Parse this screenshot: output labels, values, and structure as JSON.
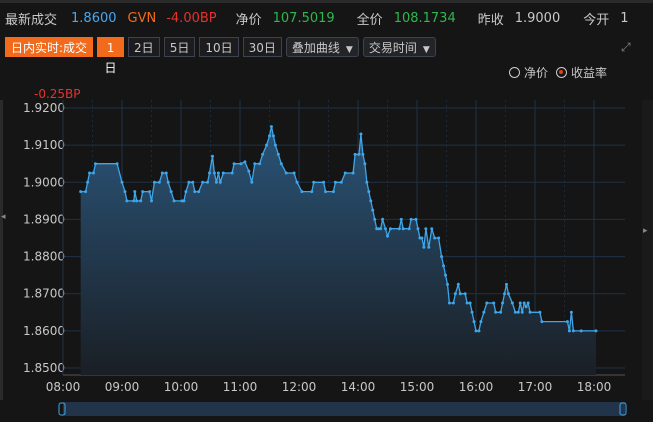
{
  "quote": {
    "latest_label": "最新成交",
    "latest": "1.8600",
    "gvn_label": "GVN",
    "gvn": "-4.00BP",
    "net_label": "净价",
    "net": "107.5019",
    "full_label": "全价",
    "full": "108.1734",
    "prev_label": "昨收",
    "prev": "1.9000",
    "open_label": "今开",
    "open": "1"
  },
  "toolbar": {
    "mode": "日内实时:成交",
    "ranges": [
      "1日",
      "2日",
      "5日",
      "10日",
      "30日"
    ],
    "active_range": "1日",
    "overlay": "叠加曲线",
    "hours": "交易时间"
  },
  "radio": {
    "net": "净价",
    "yield": "收益率",
    "selected": "yield"
  },
  "colors": {
    "accent": "#f26a1b",
    "line": "#3ea6ea",
    "up": "#2db84d",
    "down": "#e8312b",
    "blue": "#4aa8f0"
  },
  "chart_data": {
    "type": "area",
    "annotation": "-0.25BP",
    "ylim": [
      1.85,
      1.92
    ],
    "yticks": [
      "1.9200",
      "1.9100",
      "1.9000",
      "1.8900",
      "1.8800",
      "1.8700",
      "1.8600",
      "1.8500"
    ],
    "xticks": [
      "08:00",
      "09:00",
      "10:00",
      "11:00",
      "12:00",
      "14:00",
      "15:00",
      "16:00",
      "17:00",
      "18:00"
    ],
    "lunch_break": [
      "12:00",
      "13:00"
    ],
    "points": [
      [
        "08:18",
        1.8975
      ],
      [
        "08:23",
        1.8975
      ],
      [
        "08:25",
        1.9
      ],
      [
        "08:27",
        1.9025
      ],
      [
        "08:31",
        1.9025
      ],
      [
        "08:33",
        1.905
      ],
      [
        "08:55",
        1.905
      ],
      [
        "09:00",
        1.9
      ],
      [
        "09:03",
        1.8975
      ],
      [
        "09:05",
        1.895
      ],
      [
        "09:12",
        1.895
      ],
      [
        "09:13",
        1.8975
      ],
      [
        "09:15",
        1.895
      ],
      [
        "09:19",
        1.895
      ],
      [
        "09:21",
        1.8975
      ],
      [
        "09:28",
        1.8975
      ],
      [
        "09:30",
        1.895
      ],
      [
        "09:33",
        1.9
      ],
      [
        "09:38",
        1.9
      ],
      [
        "09:41",
        1.9025
      ],
      [
        "09:45",
        1.9025
      ],
      [
        "09:47",
        1.9
      ],
      [
        "09:50",
        1.8975
      ],
      [
        "09:53",
        1.895
      ],
      [
        "10:01",
        1.895
      ],
      [
        "10:03",
        1.895
      ],
      [
        "10:05",
        1.8975
      ],
      [
        "10:08",
        1.9
      ],
      [
        "10:12",
        1.9
      ],
      [
        "10:14",
        1.8975
      ],
      [
        "10:18",
        1.8975
      ],
      [
        "10:22",
        1.9
      ],
      [
        "10:27",
        1.9
      ],
      [
        "10:29",
        1.9025
      ],
      [
        "10:32",
        1.907
      ],
      [
        "10:34",
        1.9025
      ],
      [
        "10:36",
        1.9
      ],
      [
        "10:38",
        1.9025
      ],
      [
        "10:40",
        1.9
      ],
      [
        "10:43",
        1.9025
      ],
      [
        "10:52",
        1.9025
      ],
      [
        "10:54",
        1.905
      ],
      [
        "11:01",
        1.905
      ],
      [
        "11:05",
        1.9055
      ],
      [
        "11:09",
        1.903
      ],
      [
        "11:12",
        1.9
      ],
      [
        "11:15",
        1.905
      ],
      [
        "11:20",
        1.905
      ],
      [
        "11:23",
        1.9075
      ],
      [
        "11:27",
        1.91
      ],
      [
        "11:30",
        1.9125
      ],
      [
        "11:32",
        1.915
      ],
      [
        "11:34",
        1.9125
      ],
      [
        "11:36",
        1.91
      ],
      [
        "11:39",
        1.9075
      ],
      [
        "11:42",
        1.905
      ],
      [
        "11:47",
        1.9025
      ],
      [
        "11:55",
        1.9025
      ],
      [
        "11:58",
        1.9
      ],
      [
        "13:03",
        1.8975
      ],
      [
        "13:13",
        1.8975
      ],
      [
        "13:15",
        1.9
      ],
      [
        "13:25",
        1.9
      ],
      [
        "13:27",
        1.8975
      ],
      [
        "13:35",
        1.8975
      ],
      [
        "13:37",
        1.9
      ],
      [
        "13:43",
        1.9
      ],
      [
        "13:47",
        1.9025
      ],
      [
        "13:55",
        1.9025
      ],
      [
        "13:57",
        1.9075
      ],
      [
        "14:01",
        1.9075
      ],
      [
        "14:03",
        1.913
      ],
      [
        "14:05",
        1.9075
      ],
      [
        "14:07",
        1.905
      ],
      [
        "14:09",
        1.9
      ],
      [
        "14:11",
        1.8975
      ],
      [
        "14:13",
        1.895
      ],
      [
        "14:15",
        1.8925
      ],
      [
        "14:17",
        1.89
      ],
      [
        "14:19",
        1.8875
      ],
      [
        "14:21",
        1.8875
      ],
      [
        "14:23",
        1.8875
      ],
      [
        "14:25",
        1.89
      ],
      [
        "14:28",
        1.8875
      ],
      [
        "14:30",
        1.8855
      ],
      [
        "14:33",
        1.8875
      ],
      [
        "14:42",
        1.8875
      ],
      [
        "14:44",
        1.89
      ],
      [
        "14:46",
        1.8875
      ],
      [
        "14:52",
        1.8875
      ],
      [
        "14:54",
        1.89
      ],
      [
        "14:59",
        1.89
      ],
      [
        "15:01",
        1.8875
      ],
      [
        "15:03",
        1.885
      ],
      [
        "15:05",
        1.885
      ],
      [
        "15:07",
        1.8825
      ],
      [
        "15:09",
        1.8875
      ],
      [
        "15:12",
        1.8825
      ],
      [
        "15:15",
        1.8875
      ],
      [
        "15:18",
        1.885
      ],
      [
        "15:22",
        1.885
      ],
      [
        "15:25",
        1.88
      ],
      [
        "15:27",
        1.8775
      ],
      [
        "15:29",
        1.875
      ],
      [
        "15:31",
        1.8725
      ],
      [
        "15:33",
        1.8675
      ],
      [
        "15:37",
        1.8675
      ],
      [
        "15:39",
        1.87
      ],
      [
        "15:42",
        1.8725
      ],
      [
        "15:44",
        1.87
      ],
      [
        "15:49",
        1.87
      ],
      [
        "15:51",
        1.8675
      ],
      [
        "15:54",
        1.8675
      ],
      [
        "15:56",
        1.865
      ],
      [
        "15:58",
        1.8625
      ],
      [
        "16:00",
        1.86
      ],
      [
        "16:03",
        1.86
      ],
      [
        "16:05",
        1.8625
      ],
      [
        "16:08",
        1.865
      ],
      [
        "16:11",
        1.8675
      ],
      [
        "16:18",
        1.8675
      ],
      [
        "16:20",
        1.865
      ],
      [
        "16:25",
        1.865
      ],
      [
        "16:27",
        1.8675
      ],
      [
        "16:29",
        1.87
      ],
      [
        "16:31",
        1.8725
      ],
      [
        "16:33",
        1.87
      ],
      [
        "16:37",
        1.8675
      ],
      [
        "16:40",
        1.865
      ],
      [
        "16:43",
        1.865
      ],
      [
        "16:45",
        1.8675
      ],
      [
        "16:47",
        1.865
      ],
      [
        "16:49",
        1.8675
      ],
      [
        "16:51",
        1.8665
      ],
      [
        "16:53",
        1.8675
      ],
      [
        "16:55",
        1.865
      ],
      [
        "17:05",
        1.865
      ],
      [
        "17:07",
        1.8625
      ],
      [
        "17:33",
        1.8625
      ],
      [
        "17:35",
        1.86
      ],
      [
        "17:37",
        1.865
      ],
      [
        "17:39",
        1.86
      ],
      [
        "17:47",
        1.86
      ],
      [
        "18:02",
        1.86
      ]
    ]
  }
}
